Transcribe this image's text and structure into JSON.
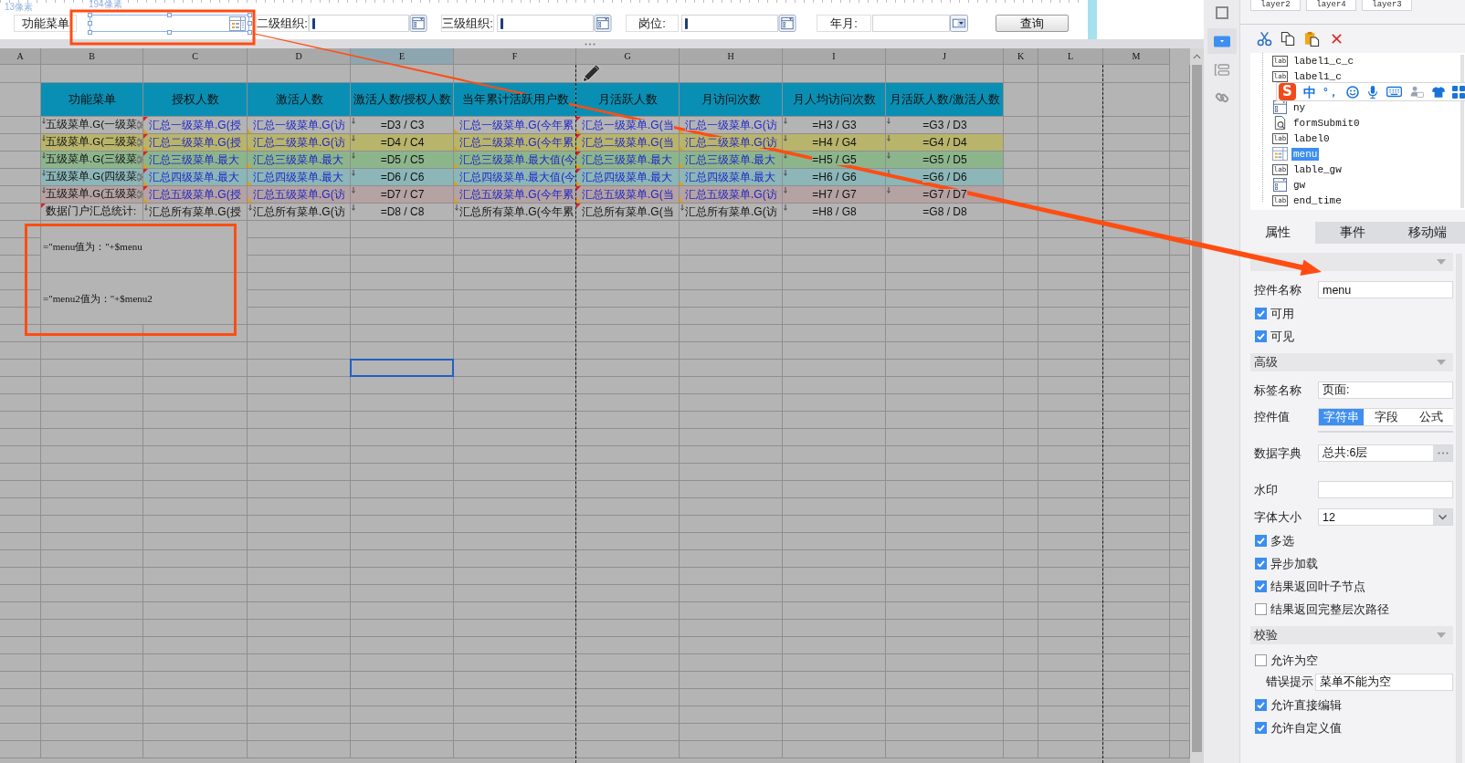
{
  "parameter_panel": {
    "dimension_labels": [
      "13像素",
      "194像素"
    ],
    "widgets": [
      {
        "kind": "label",
        "text": "功能菜单",
        "selected": false
      },
      {
        "kind": "tree",
        "selected": true
      },
      {
        "kind": "label",
        "text": "二级组织:",
        "selected": false
      },
      {
        "kind": "combo",
        "selected": false
      },
      {
        "kind": "label",
        "text": "三级组织:",
        "selected": false
      },
      {
        "kind": "combo",
        "selected": false
      },
      {
        "kind": "label",
        "text": "岗位:",
        "selected": false
      },
      {
        "kind": "combo",
        "selected": false
      },
      {
        "kind": "label",
        "text": "年月:",
        "selected": false
      },
      {
        "kind": "date",
        "selected": false
      },
      {
        "kind": "button",
        "text": "查询",
        "selected": false
      }
    ]
  },
  "sheet": {
    "columns": [
      {
        "label": "A",
        "selected": false
      },
      {
        "label": "B",
        "selected": false
      },
      {
        "label": "C",
        "selected": false
      },
      {
        "label": "D",
        "selected": false
      },
      {
        "label": "E",
        "selected": true
      },
      {
        "label": "F",
        "selected": false
      },
      {
        "label": "G",
        "selected": false
      },
      {
        "label": "H",
        "selected": false
      },
      {
        "label": "I",
        "selected": false
      },
      {
        "label": "J",
        "selected": false
      },
      {
        "label": "K",
        "selected": false
      },
      {
        "label": "L",
        "selected": false
      },
      {
        "label": "M",
        "selected": false
      }
    ],
    "header": {
      "cells": [
        {
          "text": ""
        },
        {
          "text": "功能菜单"
        },
        {
          "text": "授权人数"
        },
        {
          "text": "激活人数"
        },
        {
          "text": "激活人数/授权人数"
        },
        {
          "text": "当年累计活跃用户数"
        },
        {
          "text": "月活跃人数"
        },
        {
          "text": "月访问次数"
        },
        {
          "text": "月人均访问次数"
        },
        {
          "text": "月活跃人数/激活人数"
        }
      ]
    },
    "rows": [
      {
        "cells": [
          {
            "text": ""
          },
          {
            "text": "五级菜单.G(一级菜",
            "kind": "text",
            "marks": [
              {
                "kind": "arrow"
              },
              {
                "kind": "gear"
              }
            ]
          },
          {
            "text": "汇总一级菜单.G(授",
            "kind": "data",
            "marks": [
              {
                "kind": "flag"
              },
              {
                "kind": "note"
              }
            ]
          },
          {
            "text": "汇总一级菜单.G(访",
            "kind": "data",
            "marks": [
              {
                "kind": "note"
              }
            ]
          },
          {
            "text": "=D3 / C3",
            "kind": "formula",
            "marks": [
              {
                "kind": "arrow"
              }
            ]
          },
          {
            "text": "汇总一级菜单.G(今年累",
            "kind": "data",
            "marks": [
              {
                "kind": "note"
              }
            ]
          },
          {
            "text": "汇总一级菜单.G(当",
            "kind": "data",
            "marks": [
              {
                "kind": "flag"
              },
              {
                "kind": "note"
              }
            ]
          },
          {
            "text": "汇总一级菜单.G(访",
            "kind": "data",
            "marks": [
              {
                "kind": "note"
              }
            ]
          },
          {
            "text": "=H3 / G3",
            "kind": "formula",
            "marks": [
              {
                "kind": "arrow"
              }
            ]
          },
          {
            "text": "=G3 / D3",
            "kind": "formula",
            "marks": [
              {
                "kind": "arrow"
              }
            ]
          }
        ]
      },
      {
        "color": "#b8b46c",
        "cells": [
          {
            "text": ""
          },
          {
            "text": "五级菜单.G(二级菜",
            "kind": "text",
            "marks": [
              {
                "kind": "arrow"
              },
              {
                "kind": "gear"
              }
            ]
          },
          {
            "text": "汇总二级菜单.G(授",
            "kind": "data",
            "marks": [
              {
                "kind": "flag"
              },
              {
                "kind": "note"
              }
            ]
          },
          {
            "text": "汇总二级菜单.G(访",
            "kind": "data",
            "marks": [
              {
                "kind": "note"
              }
            ]
          },
          {
            "text": "=D4 / C4",
            "kind": "formula",
            "marks": [
              {
                "kind": "arrow"
              }
            ]
          },
          {
            "text": "汇总二级菜单.G(今年累",
            "kind": "data",
            "marks": [
              {
                "kind": "note"
              }
            ]
          },
          {
            "text": "汇总二级菜单.G(当",
            "kind": "data",
            "marks": [
              {
                "kind": "flag"
              },
              {
                "kind": "note"
              }
            ]
          },
          {
            "text": "汇总二级菜单.G(访",
            "kind": "data",
            "marks": [
              {
                "kind": "note"
              }
            ]
          },
          {
            "text": "=H4 / G4",
            "kind": "formula",
            "marks": [
              {
                "kind": "arrow"
              }
            ]
          },
          {
            "text": "=G4 / D4",
            "kind": "formula",
            "marks": [
              {
                "kind": "arrow"
              }
            ]
          }
        ]
      },
      {
        "color": "#8db58c",
        "cells": [
          {
            "text": ""
          },
          {
            "text": "五级菜单.G(三级菜",
            "kind": "text",
            "marks": [
              {
                "kind": "arrow"
              },
              {
                "kind": "gear"
              }
            ]
          },
          {
            "text": "汇总三级菜单.最大",
            "kind": "data",
            "marks": [
              {
                "kind": "flag"
              },
              {
                "kind": "note"
              }
            ]
          },
          {
            "text": "汇总三级菜单.最大",
            "kind": "data",
            "marks": [
              {
                "kind": "note"
              }
            ]
          },
          {
            "text": "=D5 / C5",
            "kind": "formula",
            "marks": [
              {
                "kind": "arrow"
              }
            ]
          },
          {
            "text": "汇总三级菜单.最大值(今",
            "kind": "data",
            "marks": [
              {
                "kind": "note"
              }
            ]
          },
          {
            "text": "汇总三级菜单.最大",
            "kind": "data",
            "marks": [
              {
                "kind": "flag"
              },
              {
                "kind": "note"
              }
            ]
          },
          {
            "text": "汇总三级菜单.最大",
            "kind": "data",
            "marks": [
              {
                "kind": "note"
              }
            ]
          },
          {
            "text": "=H5 / G5",
            "kind": "formula",
            "marks": [
              {
                "kind": "arrow"
              }
            ]
          },
          {
            "text": "=G5 / D5",
            "kind": "formula",
            "marks": [
              {
                "kind": "arrow"
              }
            ]
          }
        ]
      },
      {
        "color": "#8cb6b8",
        "cells": [
          {
            "text": ""
          },
          {
            "text": "五级菜单.G(四级菜",
            "kind": "text",
            "marks": [
              {
                "kind": "arrow"
              },
              {
                "kind": "gear"
              }
            ]
          },
          {
            "text": "汇总四级菜单.最大",
            "kind": "data",
            "marks": [
              {
                "kind": "flag"
              },
              {
                "kind": "note"
              }
            ]
          },
          {
            "text": "汇总四级菜单.最大",
            "kind": "data",
            "marks": [
              {
                "kind": "note"
              }
            ]
          },
          {
            "text": "=D6 / C6",
            "kind": "formula",
            "marks": [
              {
                "kind": "arrow"
              }
            ]
          },
          {
            "text": "汇总四级菜单.最大值(今",
            "kind": "data",
            "marks": [
              {
                "kind": "note"
              }
            ]
          },
          {
            "text": "汇总四级菜单.最大",
            "kind": "data",
            "marks": [
              {
                "kind": "flag"
              },
              {
                "kind": "note"
              }
            ]
          },
          {
            "text": "汇总四级菜单.最大",
            "kind": "data",
            "marks": [
              {
                "kind": "note"
              }
            ]
          },
          {
            "text": "=H6 / G6",
            "kind": "formula",
            "marks": [
              {
                "kind": "arrow"
              }
            ]
          },
          {
            "text": "=G6 / D6",
            "kind": "formula",
            "marks": [
              {
                "kind": "arrow"
              }
            ]
          }
        ]
      },
      {
        "color": "#b5a2a2",
        "cells": [
          {
            "text": ""
          },
          {
            "text": "五级菜单.G(五级菜",
            "kind": "text",
            "marks": [
              {
                "kind": "arrow"
              },
              {
                "kind": "gear"
              }
            ]
          },
          {
            "text": "汇总五级菜单.G(授",
            "kind": "data",
            "marks": [
              {
                "kind": "flag"
              },
              {
                "kind": "note"
              }
            ]
          },
          {
            "text": "汇总五级菜单.G(访",
            "kind": "data",
            "marks": [
              {
                "kind": "note"
              }
            ]
          },
          {
            "text": "=D7 / C7",
            "kind": "formula",
            "marks": [
              {
                "kind": "arrow"
              }
            ]
          },
          {
            "text": "汇总五级菜单.G(今年累",
            "kind": "data",
            "marks": [
              {
                "kind": "note"
              }
            ]
          },
          {
            "text": "汇总五级菜单.G(当",
            "kind": "data",
            "marks": [
              {
                "kind": "flag"
              },
              {
                "kind": "note"
              }
            ]
          },
          {
            "text": "汇总五级菜单.G(访",
            "kind": "data",
            "marks": [
              {
                "kind": "note"
              }
            ]
          },
          {
            "text": "=H7 / G7",
            "kind": "formula",
            "marks": [
              {
                "kind": "arrow"
              }
            ]
          },
          {
            "text": "=G7 / D7",
            "kind": "formula",
            "marks": [
              {
                "kind": "arrow"
              }
            ]
          }
        ]
      },
      {
        "cells": [
          {
            "text": ""
          },
          {
            "text": "数据门户汇总统计:",
            "kind": "text",
            "marks": [
              {
                "kind": "flag"
              }
            ]
          },
          {
            "text": "汇总所有菜单.G(授",
            "kind": "text",
            "marks": [
              {
                "kind": "arrow"
              }
            ]
          },
          {
            "text": "汇总所有菜单.G(访",
            "kind": "text",
            "marks": [
              {
                "kind": "arrow"
              }
            ]
          },
          {
            "text": "=D8 / C8",
            "kind": "formula",
            "marks": [
              {
                "kind": "arrow"
              }
            ]
          },
          {
            "text": "汇总所有菜单.G(今年累",
            "kind": "text",
            "marks": [
              {
                "kind": "arrow"
              }
            ]
          },
          {
            "text": "汇总所有菜单.G(当",
            "kind": "text",
            "marks": [
              {
                "kind": "flag"
              }
            ]
          },
          {
            "text": "汇总所有菜单.G(访",
            "kind": "text",
            "marks": [
              {
                "kind": "arrow"
              }
            ]
          },
          {
            "text": "=H8 / G8",
            "kind": "formula",
            "marks": [
              {
                "kind": "arrow"
              }
            ]
          },
          {
            "text": "=G8 / D8",
            "kind": "formula"
          }
        ]
      }
    ],
    "notes": [
      {
        "text": "=\"menu值为：\"+$menu"
      },
      {
        "text": "=\"menu2值为：\"+$menu2"
      }
    ],
    "blank_rows": [
      {
        "selected": false
      },
      {
        "selected": false
      },
      {
        "selected": false
      },
      {
        "selected": false
      },
      {
        "selected": false
      },
      {
        "selected": false
      },
      {
        "selected": false
      },
      {
        "selected": false
      },
      {
        "selected": true
      },
      {
        "selected": false
      },
      {
        "selected": false
      },
      {
        "selected": false
      },
      {
        "selected": false
      },
      {
        "selected": false
      },
      {
        "selected": false
      },
      {
        "selected": false
      },
      {
        "selected": false
      },
      {
        "selected": false
      },
      {
        "selected": false
      },
      {
        "selected": false
      },
      {
        "selected": false
      },
      {
        "selected": false
      },
      {
        "selected": false
      },
      {
        "selected": false
      },
      {
        "selected": false
      },
      {
        "selected": false
      },
      {
        "selected": false
      },
      {
        "selected": false
      },
      {
        "selected": false
      },
      {
        "selected": false
      },
      {
        "selected": false
      }
    ]
  },
  "side_toolbar": [
    {
      "kind": "frame",
      "selected": false
    },
    {
      "kind": "dropdown",
      "selected": true
    },
    {
      "kind": "layout",
      "selected": false
    },
    {
      "kind": "link",
      "selected": false
    }
  ],
  "layer_tabs": [
    "layer2",
    "layer4",
    "layer3"
  ],
  "widget_tree": {
    "items": [
      {
        "kind": "label",
        "badge": "lab",
        "name": "label1_c_c",
        "selected": false
      },
      {
        "kind": "label",
        "badge": "lab",
        "name": "label1_c",
        "selected": false
      },
      {
        "kind": "combo",
        "name": "ny",
        "selected": false
      },
      {
        "kind": "submit",
        "name": "formSubmit0",
        "selected": false
      },
      {
        "kind": "label",
        "badge": "lab",
        "name": "label0",
        "selected": false
      },
      {
        "kind": "tree",
        "name": "menu",
        "selected": true
      },
      {
        "kind": "label",
        "badge": "lab",
        "name": "lable_gw",
        "selected": false
      },
      {
        "kind": "combo",
        "name": "gw",
        "selected": false
      },
      {
        "kind": "label",
        "badge": "lab",
        "name": "end_time",
        "selected": false
      }
    ]
  },
  "ime_toolbar": {
    "logo": "S",
    "mode": "中",
    "punctuation": "°，"
  },
  "property_tabs": [
    {
      "label": "属性",
      "selected": true
    },
    {
      "label": "事件",
      "selected": false
    },
    {
      "label": "移动端",
      "selected": false
    }
  ],
  "properties": [
    {
      "kind": "section",
      "expanded": true
    },
    {
      "kind": "text",
      "label": "控件名称",
      "value": "menu"
    },
    {
      "kind": "checkbox",
      "label": "可用",
      "checked": true
    },
    {
      "kind": "checkbox",
      "label": "可见",
      "checked": true
    },
    {
      "kind": "section",
      "title": "高级",
      "expanded": true
    },
    {
      "kind": "text",
      "label": "标签名称",
      "value": "页面:"
    },
    {
      "kind": "segmented",
      "label": "控件值",
      "options": [
        {
          "label": "字符串",
          "selected": true
        },
        {
          "label": "字段",
          "selected": false
        },
        {
          "label": "公式",
          "selected": false
        }
      ]
    },
    {
      "kind": "dict",
      "label": "数据字典",
      "value": "总共:6层"
    },
    {
      "kind": "text",
      "label": "水印"
    },
    {
      "kind": "select",
      "label": "字体大小",
      "value": "12"
    },
    {
      "kind": "checkbox",
      "label": "多选",
      "checked": true
    },
    {
      "kind": "checkbox",
      "label": "异步加载",
      "checked": true
    },
    {
      "kind": "checkbox",
      "label": "结果返回叶子节点",
      "checked": true
    },
    {
      "kind": "checkbox",
      "label": "结果返回完整层次路径",
      "checked": false
    },
    {
      "kind": "section",
      "title": "校验",
      "expanded": true
    },
    {
      "kind": "checkbox",
      "label": "允许为空",
      "checked": false
    },
    {
      "kind": "subfield",
      "label": "错误提示",
      "value": "菜单不能为空"
    },
    {
      "kind": "checkbox",
      "label": "允许直接编辑",
      "checked": true
    },
    {
      "kind": "checkbox",
      "label": "允许自定义值",
      "checked": true
    }
  ]
}
